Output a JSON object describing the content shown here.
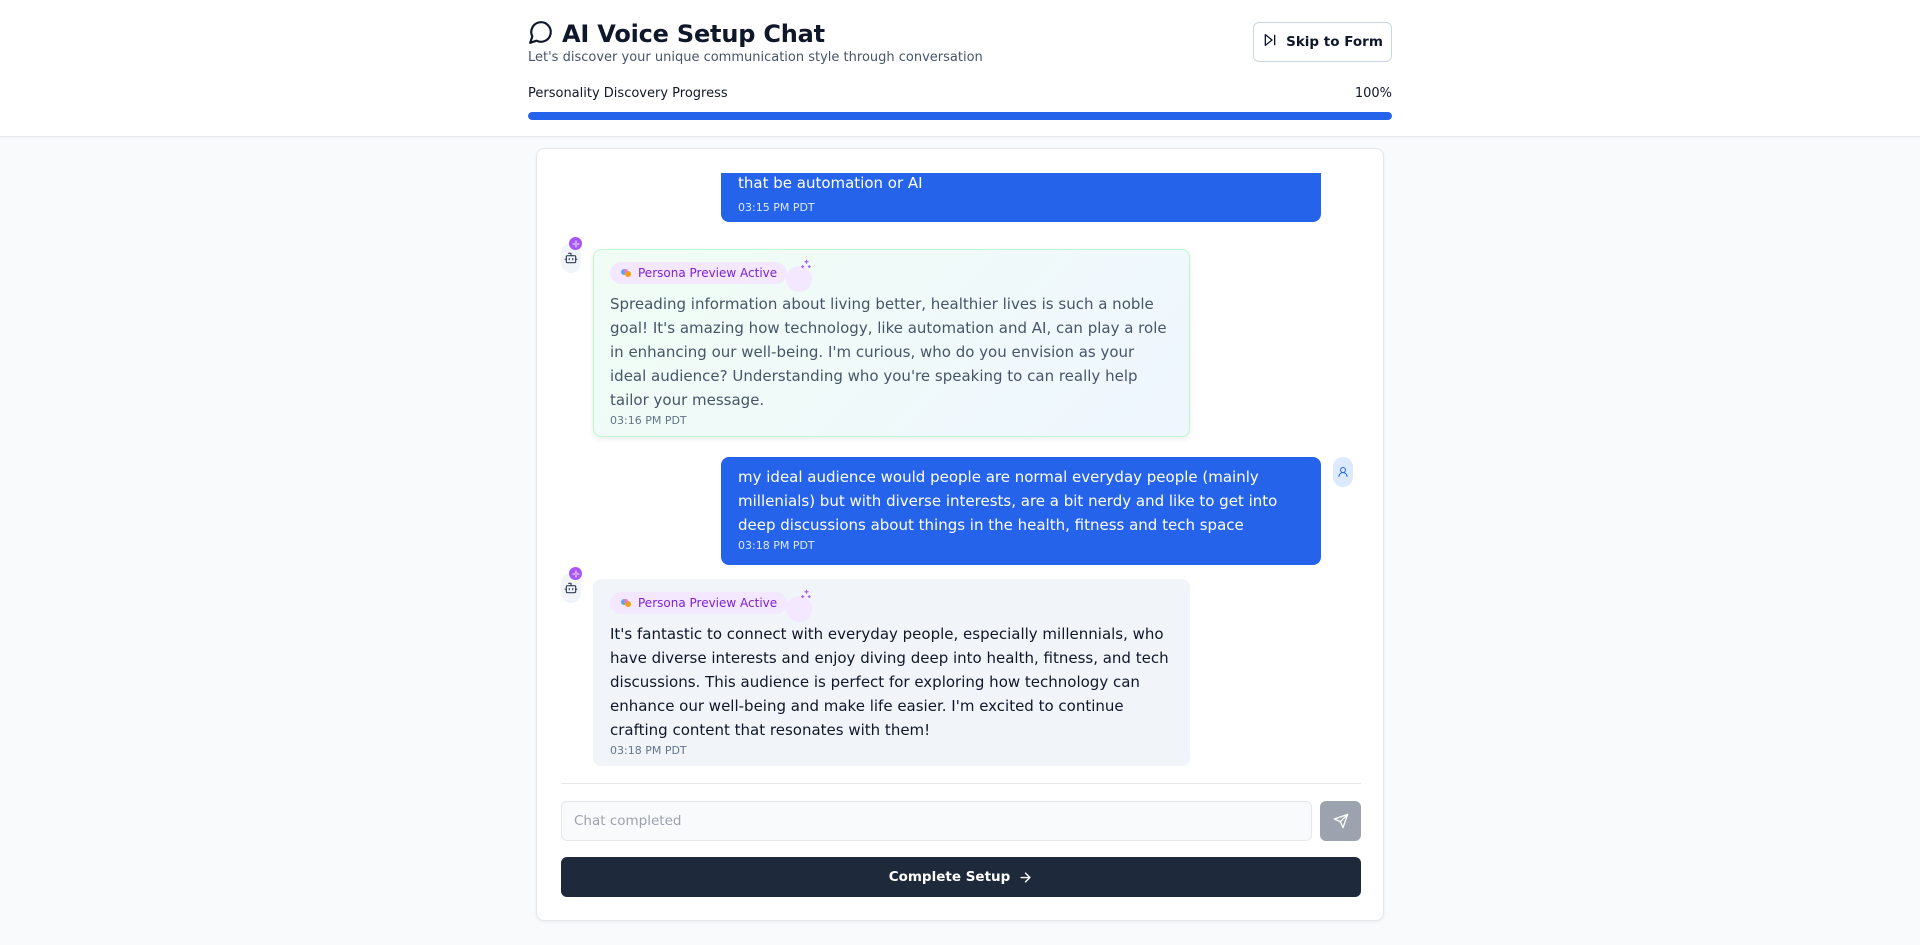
{
  "header": {
    "title": "AI Voice Setup Chat",
    "subtitle": "Let's discover your unique communication style through conversation",
    "skip_label": "Skip to Form",
    "progress_label": "Personality Discovery Progress",
    "progress_text": "100%",
    "progress_fraction": 1.0
  },
  "messages": [
    {
      "role": "user",
      "text": "and that includes how technology can make people's lives easier whether that be automation or AI",
      "time": "03:15 PM PDT"
    },
    {
      "role": "assistant",
      "badge": "Persona Preview Active",
      "text": "Spreading information about living better, healthier lives is such a noble goal! It's amazing how technology, like automation and AI, can play a role in enhancing our well-being. I'm curious, who do you envision as your ideal audience? Understanding who you're speaking to can really help tailor your message.",
      "time": "03:16 PM PDT"
    },
    {
      "role": "user",
      "text": "my ideal audience would people are normal everyday people (mainly millenials) but with diverse interests, are a bit nerdy and like to get into deep discussions about things in the health, fitness and tech space",
      "time": "03:18 PM PDT"
    },
    {
      "role": "assistant",
      "badge": "Persona Preview Active",
      "text": "It's fantastic to connect with everyday people, especially millennials, who have diverse interests and enjoy diving deep into health, fitness, and tech discussions. This audience is perfect for exploring how technology can enhance our well-being and make life easier. I'm excited to continue crafting content that resonates with them!",
      "time": "03:18 PM PDT"
    }
  ],
  "input": {
    "placeholder": "Chat completed"
  },
  "complete_label": "Complete Setup",
  "colors": {
    "accent": "#2563eb",
    "dark_button": "#1e293b",
    "persona_purple": "#7e22ce"
  },
  "icons": {
    "title": "message-circle-icon",
    "skip": "skip-forward-icon",
    "bot": "bot-icon",
    "user": "user-icon",
    "sparkle": "sparkles-icon",
    "send": "send-icon",
    "arrow": "arrow-right-icon"
  }
}
